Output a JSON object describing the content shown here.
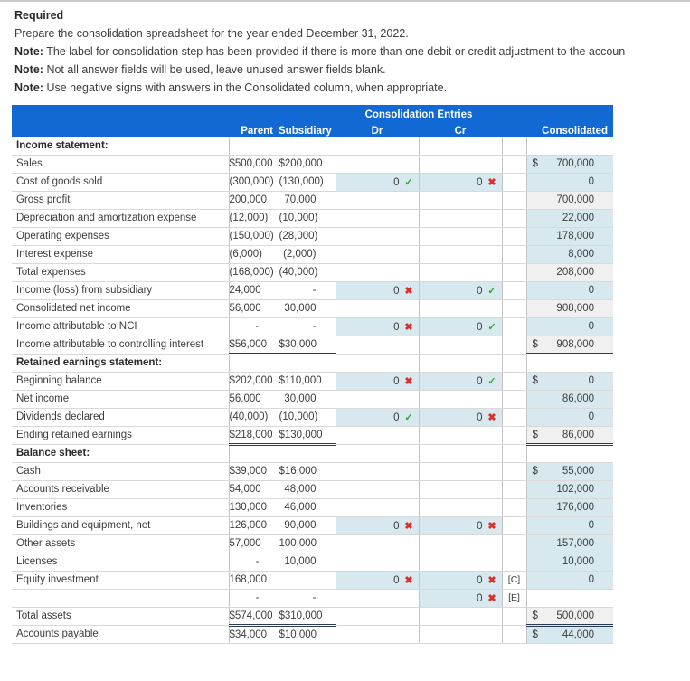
{
  "intro": {
    "required_heading": "Required",
    "line1": "Prepare the consolidation spreadsheet for the year ended December 31, 2022.",
    "note_label": "Note:",
    "note1": "The label for consolidation step has been provided if there is more than one debit or credit adjustment to the accoun",
    "note2": "Not all answer fields will be used, leave unused answer fields blank.",
    "note3": "Use negative signs with answers in the Consolidated column, when appropriate."
  },
  "table": {
    "group_header": "Consolidation Entries",
    "columns": {
      "label": "",
      "parent": "Parent",
      "subsidiary": "Subsidiary",
      "dr": "Dr",
      "cr": "Cr",
      "tag": "",
      "consolidated": "Consolidated"
    },
    "colors": {
      "header_blue": "#1269d3",
      "input_cell": "#d7e9ef",
      "calc_cell": "#f0f0f0",
      "check_green": "#34a83a",
      "cross_red": "#d9302c"
    },
    "rows": [
      {
        "label": "Income statement:",
        "section": true,
        "parent": "",
        "subsidiary": "",
        "dr": "",
        "cr": "",
        "tag": "",
        "consolidated": "",
        "dollar": false
      },
      {
        "label": "Sales",
        "parent": "$500,000",
        "subsidiary": "$200,000",
        "dr": "",
        "cr": "",
        "tag": "",
        "consolidated": "700,000",
        "con_mark": "ok",
        "con_input": true,
        "dollar": true
      },
      {
        "label": "Cost of goods sold",
        "parent": "(300,000)",
        "subsidiary": "(130,000)",
        "dr": "0",
        "dr_mark": "ok",
        "dr_input": true,
        "cr": "0",
        "cr_mark": "no",
        "cr_input": true,
        "tag": "",
        "consolidated": "0",
        "con_mark": "no",
        "con_input": true,
        "rule_bottom": true
      },
      {
        "label": "Gross profit",
        "parent": "200,000",
        "subsidiary": "70,000",
        "dr": "",
        "cr": "",
        "tag": "",
        "consolidated": "700,000",
        "con_calc": true,
        "rule_top": true
      },
      {
        "label": "Depreciation and amortization expense",
        "parent": "(12,000)",
        "subsidiary": "(10,000)",
        "dr": "",
        "cr": "",
        "tag": "",
        "consolidated": "22,000",
        "con_mark": "no",
        "con_input": true
      },
      {
        "label": "Operating expenses",
        "parent": "(150,000)",
        "subsidiary": "(28,000)",
        "dr": "",
        "cr": "",
        "tag": "",
        "consolidated": "178,000",
        "con_mark": "no",
        "con_input": true
      },
      {
        "label": "Interest expense",
        "parent": "(6,000)",
        "subsidiary": "(2,000)",
        "dr": "",
        "cr": "",
        "tag": "",
        "consolidated": "8,000",
        "con_mark": "no",
        "con_input": true,
        "rule_bottom": true
      },
      {
        "label": "Total expenses",
        "parent": "(168,000)",
        "subsidiary": "(40,000)",
        "dr": "",
        "cr": "",
        "tag": "",
        "consolidated": "208,000",
        "con_calc": true,
        "rule_top": true
      },
      {
        "label": "Income (loss) from subsidiary",
        "parent": "24,000",
        "subsidiary": "-",
        "dr": "0",
        "dr_mark": "no",
        "dr_input": true,
        "cr": "0",
        "cr_mark": "ok",
        "cr_input": true,
        "tag": "",
        "consolidated": "0",
        "con_mark": "ok",
        "con_input": true,
        "rule_bottom": true
      },
      {
        "label": "Consolidated net income",
        "parent": "56,000",
        "subsidiary": "30,000",
        "dr": "",
        "cr": "",
        "tag": "",
        "consolidated": "908,000",
        "con_calc": true,
        "rule_top": true
      },
      {
        "label": "Income attributable to NCI",
        "parent": "-",
        "subsidiary": "-",
        "dr": "0",
        "dr_mark": "no",
        "dr_input": true,
        "cr": "0",
        "cr_mark": "ok",
        "cr_input": true,
        "tag": "",
        "consolidated": "0",
        "con_mark": "no",
        "con_input": true,
        "rule_bottom": true
      },
      {
        "label": "Income attributable to controlling interest",
        "parent": "$56,000",
        "subsidiary": "$30,000",
        "dr": "",
        "cr": "",
        "tag": "",
        "consolidated": "908,000",
        "con_calc": true,
        "dollar": true,
        "rule_top": true,
        "rule_double": true
      },
      {
        "label": "Retained earnings statement:",
        "section": true,
        "parent": "",
        "subsidiary": "",
        "dr": "",
        "cr": "",
        "tag": "",
        "consolidated": ""
      },
      {
        "label": "Beginning balance",
        "parent": "$202,000",
        "subsidiary": "$110,000",
        "dr": "0",
        "dr_mark": "no",
        "dr_input": true,
        "cr": "0",
        "cr_mark": "ok",
        "cr_input": true,
        "tag": "",
        "consolidated": "0",
        "con_mark": "no",
        "con_input": true,
        "dollar": true
      },
      {
        "label": "Net income",
        "parent": "56,000",
        "subsidiary": "30,000",
        "dr": "",
        "cr": "",
        "tag": "",
        "consolidated": "86,000",
        "con_mark": "no",
        "con_input": true
      },
      {
        "label": "Dividends declared",
        "parent": "(40,000)",
        "subsidiary": "(10,000)",
        "dr": "0",
        "dr_mark": "ok",
        "dr_input": true,
        "cr": "0",
        "cr_mark": "no",
        "cr_input": true,
        "tag": "",
        "consolidated": "0",
        "con_mark": "no",
        "con_input": true,
        "rule_bottom": true
      },
      {
        "label": "Ending retained earnings",
        "parent": "$218,000",
        "subsidiary": "$130,000",
        "dr": "",
        "cr": "",
        "tag": "",
        "consolidated": "86,000",
        "con_calc": true,
        "dollar": true,
        "rule_top": true,
        "rule_double": true
      },
      {
        "label": "Balance sheet:",
        "section": true,
        "parent": "",
        "subsidiary": "",
        "dr": "",
        "cr": "",
        "tag": "",
        "consolidated": ""
      },
      {
        "label": "Cash",
        "parent": "$39,000",
        "subsidiary": "$16,000",
        "dr": "",
        "cr": "",
        "tag": "",
        "consolidated": "55,000",
        "con_mark": "ok",
        "con_input": true,
        "dollar": true
      },
      {
        "label": "Accounts receivable",
        "parent": "54,000",
        "subsidiary": "48,000",
        "dr": "",
        "cr": "",
        "tag": "",
        "consolidated": "102,000",
        "con_mark": "ok",
        "con_input": true
      },
      {
        "label": "Inventories",
        "parent": "130,000",
        "subsidiary": "46,000",
        "dr": "",
        "cr": "",
        "tag": "",
        "consolidated": "176,000",
        "con_mark": "ok",
        "con_input": true
      },
      {
        "label": "Buildings and equipment, net",
        "parent": "126,000",
        "subsidiary": "90,000",
        "dr": "0",
        "dr_mark": "no",
        "dr_input": true,
        "cr": "0",
        "cr_mark": "no",
        "cr_input": true,
        "tag": "",
        "consolidated": "0",
        "con_mark": "no",
        "con_input": true
      },
      {
        "label": "Other assets",
        "parent": "57,000",
        "subsidiary": "100,000",
        "dr": "",
        "cr": "",
        "tag": "",
        "consolidated": "157,000",
        "con_mark": "ok",
        "con_input": true
      },
      {
        "label": "Licenses",
        "parent": "-",
        "subsidiary": "10,000",
        "dr": "",
        "cr": "",
        "tag": "",
        "consolidated": "10,000",
        "con_mark": "ok",
        "con_input": true
      },
      {
        "label": "Equity investment",
        "parent": "168,000",
        "subsidiary": "",
        "dr": "0",
        "dr_mark": "no",
        "dr_input": true,
        "cr": "0",
        "cr_mark": "no",
        "cr_input": true,
        "tag": "[C]",
        "consolidated": "0",
        "con_mark": "ok",
        "con_input": true
      },
      {
        "label": "",
        "parent": "-",
        "subsidiary": "-",
        "dr": "",
        "cr": "0",
        "cr_mark": "no",
        "cr_input": true,
        "tag": "[E]",
        "consolidated": "",
        "rule_bottom": true
      },
      {
        "label": "Total assets",
        "parent": "$574,000",
        "subsidiary": "$310,000",
        "dr": "",
        "cr": "",
        "tag": "",
        "consolidated": "500,000",
        "con_calc": true,
        "dollar": true,
        "rule_top": true,
        "rule_double": true
      },
      {
        "label": "Accounts payable",
        "parent": "$34,000",
        "subsidiary": "$10,000",
        "dr": "",
        "cr": "",
        "tag": "",
        "consolidated": "44,000",
        "con_mark": "ok",
        "con_input": true,
        "dollar": true
      }
    ]
  }
}
